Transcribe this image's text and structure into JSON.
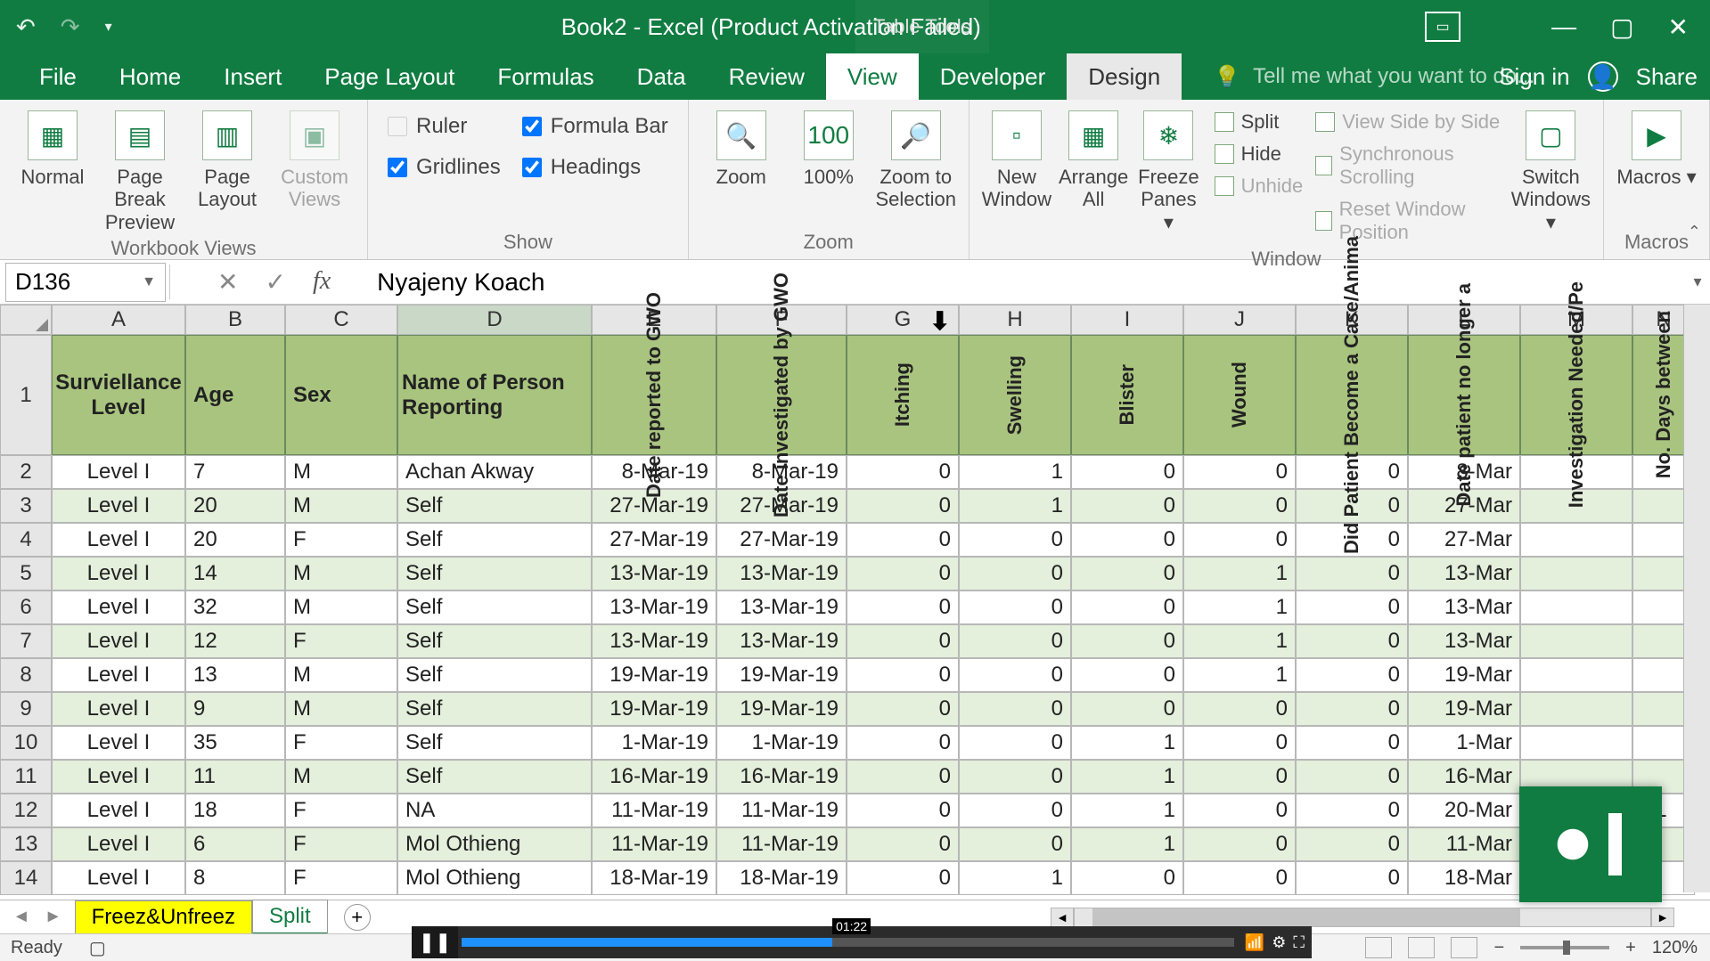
{
  "title": "Book2 - Excel (Product Activation Failed)",
  "contextual_tab_group": "Table Tools",
  "tabs": [
    "File",
    "Home",
    "Insert",
    "Page Layout",
    "Formulas",
    "Data",
    "Review",
    "View",
    "Developer",
    "Design"
  ],
  "active_tab": "View",
  "tellme_placeholder": "Tell me what you want to do...",
  "signin": "Sign in",
  "share": "Share",
  "ribbon": {
    "workbook_views": {
      "normal": "Normal",
      "page_break": "Page Break Preview",
      "page_layout": "Page Layout",
      "custom": "Custom Views",
      "label": "Workbook Views"
    },
    "show": {
      "ruler": "Ruler",
      "formula_bar": "Formula Bar",
      "gridlines": "Gridlines",
      "headings": "Headings",
      "label": "Show"
    },
    "zoom": {
      "zoom": "Zoom",
      "z100": "100%",
      "zts": "Zoom to Selection",
      "label": "Zoom"
    },
    "window": {
      "new": "New Window",
      "arrange": "Arrange All",
      "freeze": "Freeze Panes",
      "split": "Split",
      "hide": "Hide",
      "unhide": "Unhide",
      "vsbs": "View Side by Side",
      "sync": "Synchronous Scrolling",
      "reset": "Reset Window Position",
      "switch": "Switch Windows",
      "label": "Window"
    },
    "macros": {
      "macros": "Macros",
      "label": "Macros"
    }
  },
  "namebox": "D136",
  "formula": "Nyajeny Koach",
  "columns": [
    "A",
    "B",
    "C",
    "D",
    "E",
    "F",
    "G",
    "H",
    "I",
    "J",
    "K",
    "L",
    "M",
    "N"
  ],
  "headers": {
    "A": "Surviellance Level",
    "B": "Age",
    "C": "Sex",
    "D": "Name of Person Reporting",
    "E": "Date reported to GWO",
    "F": "Date investigated by GWO",
    "G": "Itching",
    "H": "Swelling",
    "I": "Blister",
    "J": "Wound",
    "K": "Did Patient Become a Case/Anima",
    "L": "Date patient no longer a",
    "M": "Investigation Needed/Pe",
    "N": "No. Days between"
  },
  "rows": [
    {
      "n": 2,
      "A": "Level I",
      "B": "7",
      "C": "M",
      "D": "Achan Akway",
      "E": "8-Mar-19",
      "F": "8-Mar-19",
      "G": "0",
      "H": "1",
      "I": "0",
      "J": "0",
      "K": "0",
      "L": "8-Mar",
      "M": "",
      "N": ""
    },
    {
      "n": 3,
      "A": "Level I",
      "B": "20",
      "C": "M",
      "D": "Self",
      "E": "27-Mar-19",
      "F": "27-Mar-19",
      "G": "0",
      "H": "1",
      "I": "0",
      "J": "0",
      "K": "0",
      "L": "27-Mar",
      "M": "",
      "N": ""
    },
    {
      "n": 4,
      "A": "Level I",
      "B": "20",
      "C": "F",
      "D": "Self",
      "E": "27-Mar-19",
      "F": "27-Mar-19",
      "G": "0",
      "H": "0",
      "I": "0",
      "J": "0",
      "K": "0",
      "L": "27-Mar",
      "M": "",
      "N": ""
    },
    {
      "n": 5,
      "A": "Level I",
      "B": "14",
      "C": "M",
      "D": "Self",
      "E": "13-Mar-19",
      "F": "13-Mar-19",
      "G": "0",
      "H": "0",
      "I": "0",
      "J": "1",
      "K": "0",
      "L": "13-Mar",
      "M": "",
      "N": ""
    },
    {
      "n": 6,
      "A": "Level I",
      "B": "32",
      "C": "M",
      "D": "Self",
      "E": "13-Mar-19",
      "F": "13-Mar-19",
      "G": "0",
      "H": "0",
      "I": "0",
      "J": "1",
      "K": "0",
      "L": "13-Mar",
      "M": "",
      "N": ""
    },
    {
      "n": 7,
      "A": "Level I",
      "B": "12",
      "C": "F",
      "D": "Self",
      "E": "13-Mar-19",
      "F": "13-Mar-19",
      "G": "0",
      "H": "0",
      "I": "0",
      "J": "1",
      "K": "0",
      "L": "13-Mar",
      "M": "",
      "N": ""
    },
    {
      "n": 8,
      "A": "Level I",
      "B": "13",
      "C": "M",
      "D": "Self",
      "E": "19-Mar-19",
      "F": "19-Mar-19",
      "G": "0",
      "H": "0",
      "I": "0",
      "J": "1",
      "K": "0",
      "L": "19-Mar",
      "M": "",
      "N": ""
    },
    {
      "n": 9,
      "A": "Level I",
      "B": "9",
      "C": "M",
      "D": "Self",
      "E": "19-Mar-19",
      "F": "19-Mar-19",
      "G": "0",
      "H": "0",
      "I": "0",
      "J": "0",
      "K": "0",
      "L": "19-Mar",
      "M": "",
      "N": ""
    },
    {
      "n": 10,
      "A": "Level I",
      "B": "35",
      "C": "F",
      "D": "Self",
      "E": "1-Mar-19",
      "F": "1-Mar-19",
      "G": "0",
      "H": "0",
      "I": "1",
      "J": "0",
      "K": "0",
      "L": "1-Mar",
      "M": "",
      "N": ""
    },
    {
      "n": 11,
      "A": "Level I",
      "B": "11",
      "C": "M",
      "D": "Self",
      "E": "16-Mar-19",
      "F": "16-Mar-19",
      "G": "0",
      "H": "0",
      "I": "1",
      "J": "0",
      "K": "0",
      "L": "16-Mar",
      "M": "",
      "N": ""
    },
    {
      "n": 12,
      "A": "Level I",
      "B": "18",
      "C": "F",
      "D": "NA",
      "E": "11-Mar-19",
      "F": "11-Mar-19",
      "G": "0",
      "H": "0",
      "I": "1",
      "J": "0",
      "K": "0",
      "L": "20-Mar",
      "M": "",
      "N": "AL"
    },
    {
      "n": 13,
      "A": "Level I",
      "B": "6",
      "C": "F",
      "D": "Mol Othieng",
      "E": "11-Mar-19",
      "F": "11-Mar-19",
      "G": "0",
      "H": "0",
      "I": "1",
      "J": "0",
      "K": "0",
      "L": "11-Mar",
      "M": "",
      "N": ""
    },
    {
      "n": 14,
      "A": "Level I",
      "B": "8",
      "C": "F",
      "D": "Mol Othieng",
      "E": "18-Mar-19",
      "F": "18-Mar-19",
      "G": "0",
      "H": "1",
      "I": "0",
      "J": "0",
      "K": "0",
      "L": "18-Mar",
      "M": "",
      "N": ""
    }
  ],
  "sheets": {
    "s1": "Freez&Unfreez",
    "s2": "Split"
  },
  "status": {
    "ready": "Ready",
    "zoom": "120%"
  },
  "video": {
    "time": "01:22"
  }
}
